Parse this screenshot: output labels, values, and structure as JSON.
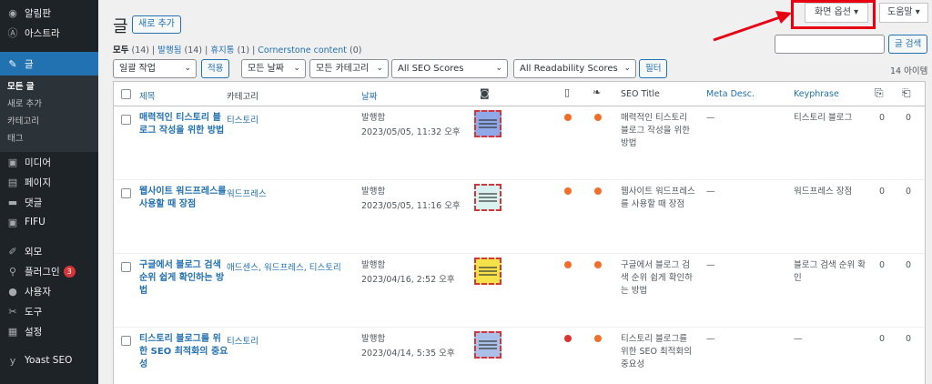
{
  "sidebar": {
    "items": [
      {
        "label": "알림판",
        "icon": "dashboard-icon"
      },
      {
        "label": "아스트라",
        "icon": "astra-icon"
      },
      {
        "label": "글",
        "icon": "pin-icon",
        "active": true
      },
      {
        "label": "미디어",
        "icon": "media-icon"
      },
      {
        "label": "페이지",
        "icon": "page-icon"
      },
      {
        "label": "댓글",
        "icon": "comment-icon"
      },
      {
        "label": "FIFU",
        "icon": "fifu-icon"
      },
      {
        "label": "외모",
        "icon": "brush-icon"
      },
      {
        "label": "플러그인",
        "icon": "plugin-icon",
        "badge": "3"
      },
      {
        "label": "사용자",
        "icon": "user-icon"
      },
      {
        "label": "도구",
        "icon": "wrench-icon"
      },
      {
        "label": "설정",
        "icon": "settings-icon"
      },
      {
        "label": "Yoast SEO",
        "icon": "yoast-icon"
      }
    ],
    "submenu": [
      "모든 글",
      "새로 추가",
      "카테고리",
      "태그"
    ]
  },
  "header": {
    "title": "글",
    "add_new": "새로 추가",
    "screen_options": "화면 옵션 ▾",
    "help": "도움말 ▾"
  },
  "views": {
    "all": "모두",
    "all_count": "(14)",
    "published": "발행됨",
    "published_count": "(14)",
    "trash": "휴지통",
    "trash_count": "(1)",
    "cornerstone": "Cornerstone content",
    "cornerstone_count": "(0)"
  },
  "search": {
    "button": "글 검색"
  },
  "filters": {
    "bulk_action": "일괄 작업",
    "apply": "적용",
    "all_dates": "모든 날짜",
    "all_categories": "모든 카테고리",
    "seo_scores": "All SEO Scores",
    "readability": "All Readability Scores",
    "filter": "필터",
    "items_count": "14 아이템"
  },
  "table": {
    "headers": {
      "title": "제목",
      "category": "카테고리",
      "date": "날짜",
      "seo_title": "SEO Title",
      "meta_desc": "Meta Desc.",
      "keyphrase": "Keyphrase"
    },
    "rows": [
      {
        "title": "매력적인 티스토리 블로그 작성을 위한 방법",
        "category": "티스토리",
        "status": "발행함",
        "date": "2023/05/05, 11:32 오후",
        "seo_color": "#f56e28",
        "read_color": "#f56e28",
        "seo_title": "매력적인 티스토리 블로그 작성을 위한 방법",
        "meta": "—",
        "keyphrase": "티스토리 블로그",
        "links": "0",
        "linked": "0",
        "thumb_color": "#8fa8e8"
      },
      {
        "title": "웹사이트 워드프레스를 사용할 때 장점",
        "category": "워드프레스",
        "status": "발행함",
        "date": "2023/05/05, 11:16 오후",
        "seo_color": "#f56e28",
        "read_color": "#f56e28",
        "seo_title": "웹사이트 워드프레스를 사용할 때 장점",
        "meta": "—",
        "keyphrase": "워드프레스 장점",
        "links": "0",
        "linked": "0",
        "thumb_color": "#d9f2ef"
      },
      {
        "title": "구글에서 블로그 검색 순위 쉽게 확인하는 방법",
        "category": "애드센스, 워드프레스, 티스토리",
        "status": "발행함",
        "date": "2023/04/16, 2:52 오후",
        "seo_color": "#f56e28",
        "read_color": "#f56e28",
        "seo_title": "구글에서 블로그 검색 순위 쉽게 확인하는 방법",
        "meta": "—",
        "keyphrase": "블로그 검색 순위 확인",
        "links": "0",
        "linked": "0",
        "thumb_color": "#f5e14a"
      },
      {
        "title": "티스토리 블로그를 위한 SEO 최적화의 중요성",
        "category": "티스토리",
        "status": "발행함",
        "date": "2023/04/14, 5:35 오후",
        "seo_color": "#dc3232",
        "read_color": "#f56e28",
        "seo_title": "티스토리 블로그를 위한 SEO 최적화의 중요성",
        "meta": "—",
        "keyphrase": "—",
        "links": "0",
        "linked": "0",
        "thumb_color": "#a9c0e8"
      }
    ]
  }
}
